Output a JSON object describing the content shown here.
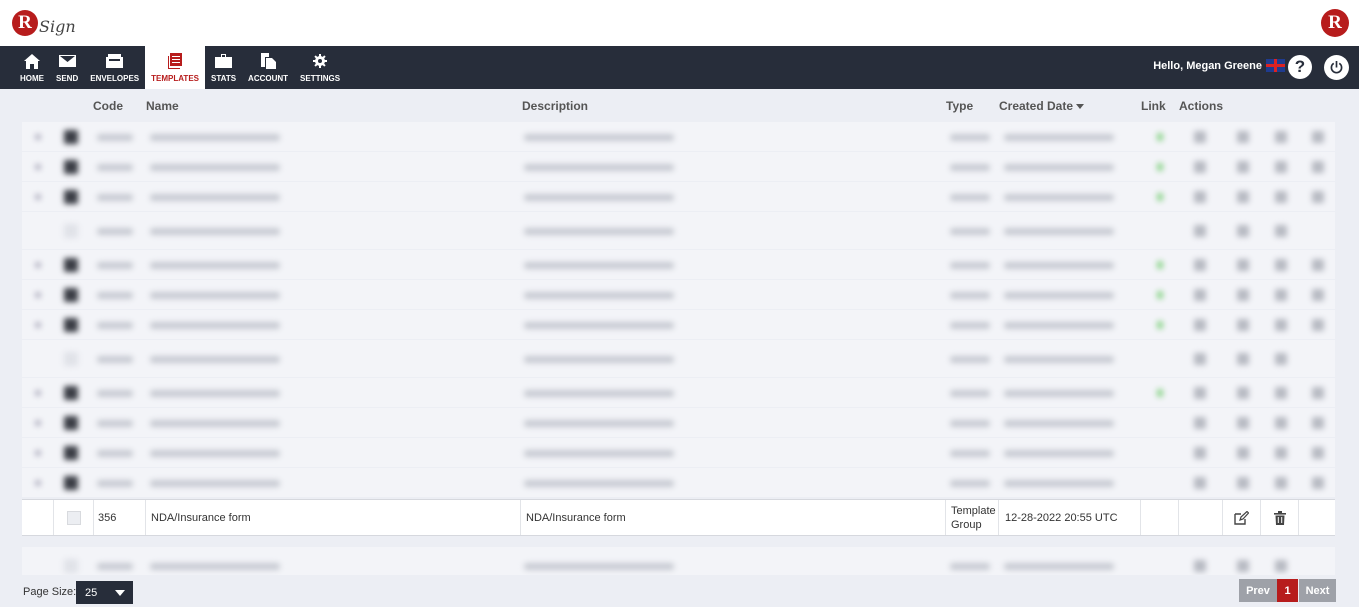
{
  "app": {
    "logo_letter": "R",
    "logo_text": "Sign",
    "brand_color": "#b71c1c"
  },
  "nav": [
    {
      "label": "HOME",
      "icon": "home-icon"
    },
    {
      "label": "SEND",
      "icon": "envelope-icon"
    },
    {
      "label": "ENVELOPES",
      "icon": "inbox-icon"
    },
    {
      "label": "TEMPLATES",
      "icon": "templates-icon",
      "active": true
    },
    {
      "label": "STATS",
      "icon": "briefcase-icon"
    },
    {
      "label": "ACCOUNT",
      "icon": "documents-icon"
    },
    {
      "label": "SETTINGS",
      "icon": "gear-icon"
    }
  ],
  "user": {
    "greeting": "Hello, Megan Greene",
    "help_label": "?"
  },
  "table": {
    "headers": {
      "code": "Code",
      "name": "Name",
      "description": "Description",
      "type": "Type",
      "created": "Created Date",
      "link": "Link",
      "actions": "Actions"
    },
    "highlighted_row": {
      "code": "356",
      "name": "NDA/Insurance form",
      "description": "NDA/Insurance form",
      "type_line1": "Template",
      "type_line2": "Group",
      "created": "12-28-2022 20:55 UTC"
    }
  },
  "footer": {
    "page_size_label": "Page Size:",
    "page_size_value": "25",
    "prev": "Prev",
    "page": "1",
    "next": "Next"
  }
}
